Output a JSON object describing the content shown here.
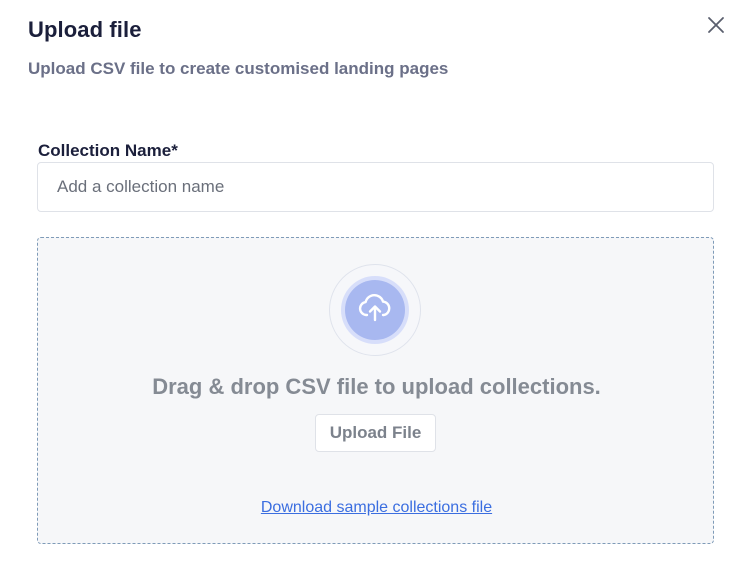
{
  "dialog": {
    "title": "Upload file",
    "subtitle": "Upload CSV file to create customised landing pages",
    "close_icon": "close-icon"
  },
  "form": {
    "collection_name_label": "Collection Name*",
    "collection_name_value": "",
    "collection_name_placeholder": "Add a collection name"
  },
  "dropzone": {
    "icon": "cloud-upload-icon",
    "instruction": "Drag & drop CSV file to upload collections.",
    "upload_button_label": "Upload File",
    "sample_link_label": "Download sample collections file"
  },
  "colors": {
    "title": "#1b1f3b",
    "subtitle": "#6b7088",
    "icon_fill": "#a8b8f0",
    "link": "#3b6ee0",
    "dropzone_border": "#7f9bb8"
  }
}
